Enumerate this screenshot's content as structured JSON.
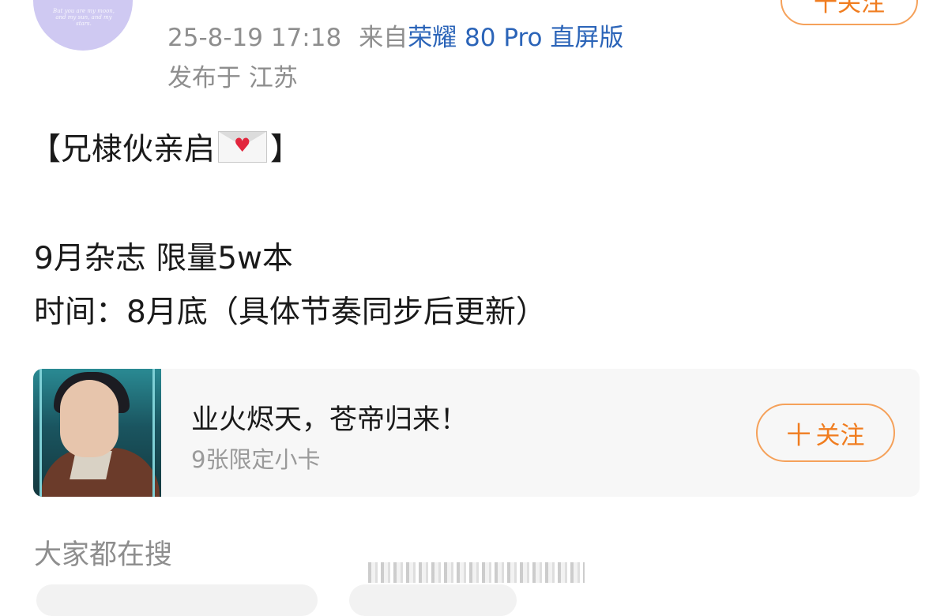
{
  "post": {
    "avatar_text": "But you are my moon, and my sun, and my stars.",
    "follow_top_label": "十关注",
    "timestamp": "25-8-19 17:18",
    "source_prefix": "来自",
    "device": "荣耀 80 Pro 直屏版",
    "location": "发布于 江苏",
    "headline_open": "【兄棣伙亲启",
    "headline_close": "】",
    "line1": "9月杂志  限量5w本",
    "line2": "时间：8月底（具体节奏同步后更新）"
  },
  "card": {
    "title": "业火烬天，苍帝归来！",
    "subtitle": "9张限定小卡",
    "follow_label": "关注",
    "plus_symbol": "十"
  },
  "search": {
    "heading": "大家都在搜"
  },
  "icons": {
    "envelope": "love-letter-envelope-icon",
    "plus": "plus-icon"
  },
  "colors": {
    "accent_orange": "#f07d20",
    "link_blue": "#2b64b8",
    "meta_gray": "#8e8e8e",
    "card_bg": "#f7f7f7"
  }
}
